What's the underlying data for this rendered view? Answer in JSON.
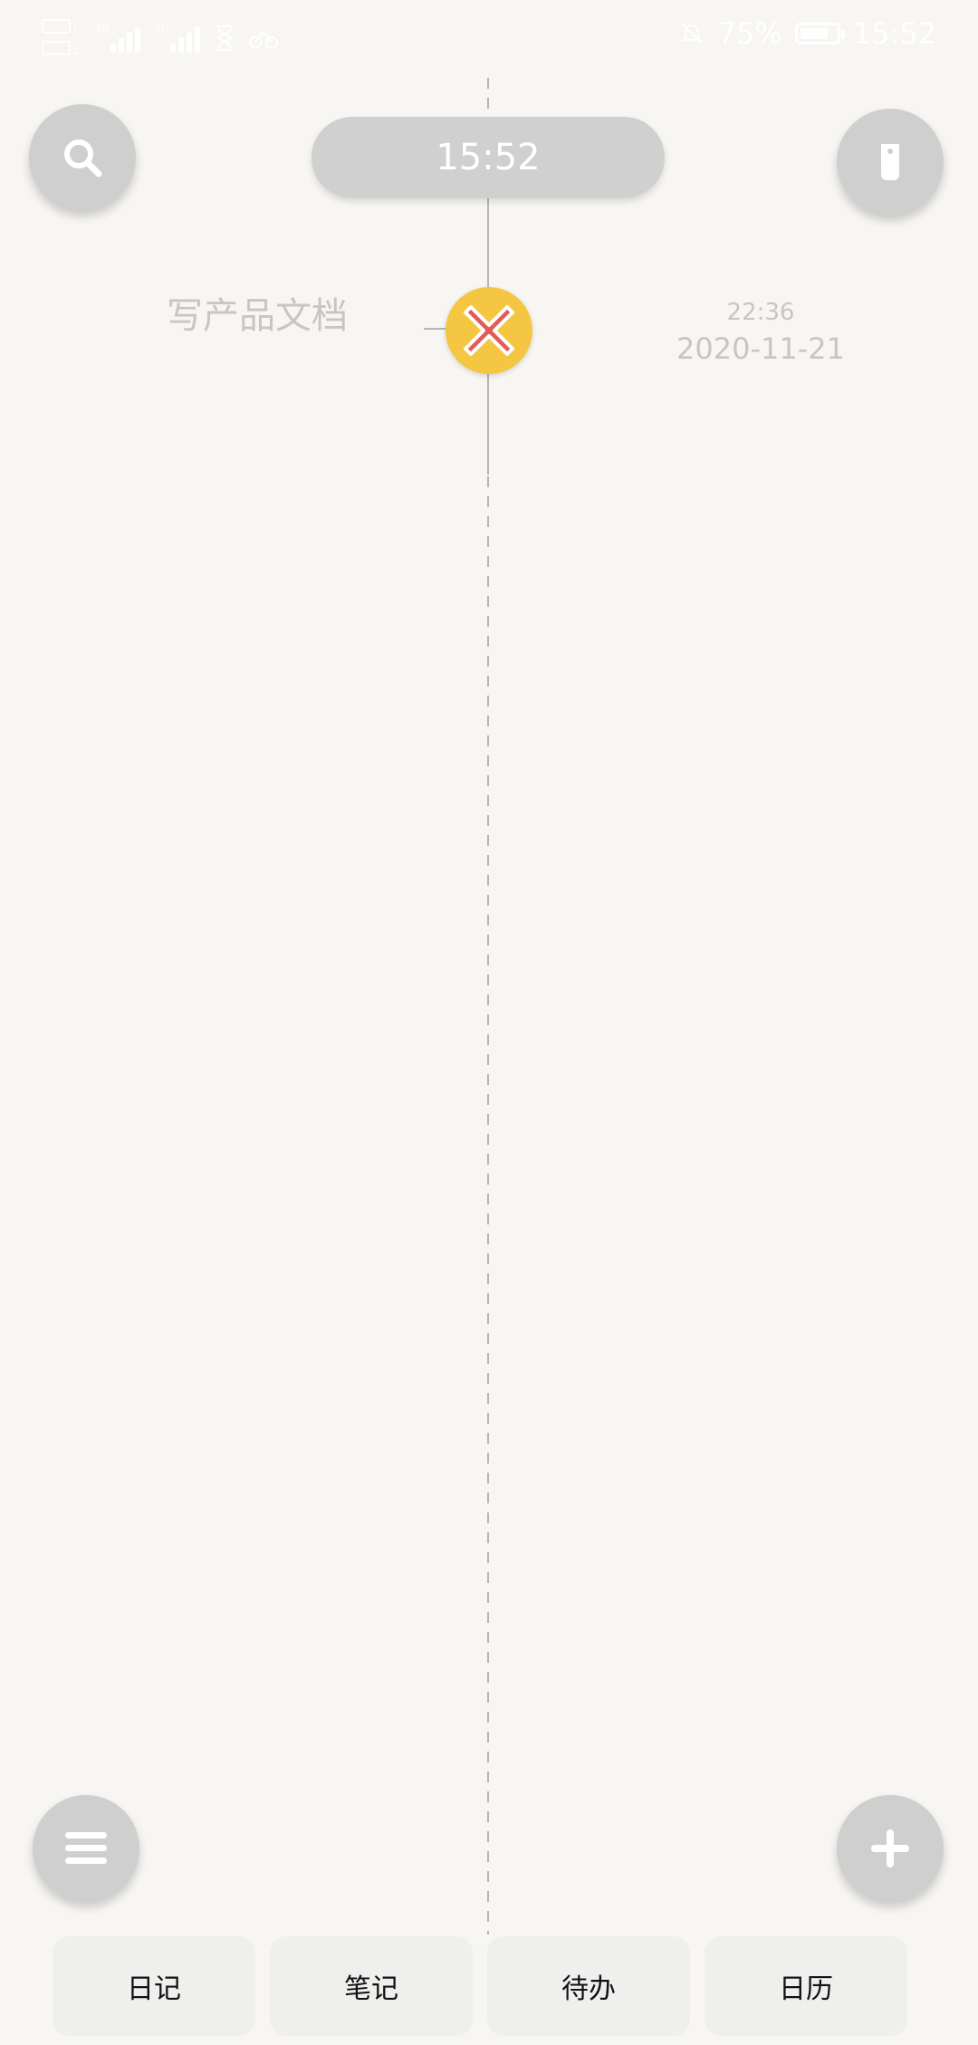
{
  "status_bar": {
    "battery_percent": "75%",
    "time": "15:52"
  },
  "header": {
    "time_pill": "15:52"
  },
  "timeline": {
    "item": {
      "title": "写产品文档",
      "time": "22:36",
      "date": "2020-11-21"
    }
  },
  "tabs": [
    {
      "label": "日记"
    },
    {
      "label": "笔记"
    },
    {
      "label": "待办"
    },
    {
      "label": "日历"
    }
  ],
  "colors": {
    "background": "#f8f6f2",
    "fab": "#cfcfcf",
    "task_icon_bg": "#f4c642",
    "task_icon_x": "#e35a5a"
  },
  "icons": {
    "search": "search-icon",
    "tag": "tag-icon",
    "menu": "menu-icon",
    "add": "plus-icon",
    "task": "close-icon"
  }
}
